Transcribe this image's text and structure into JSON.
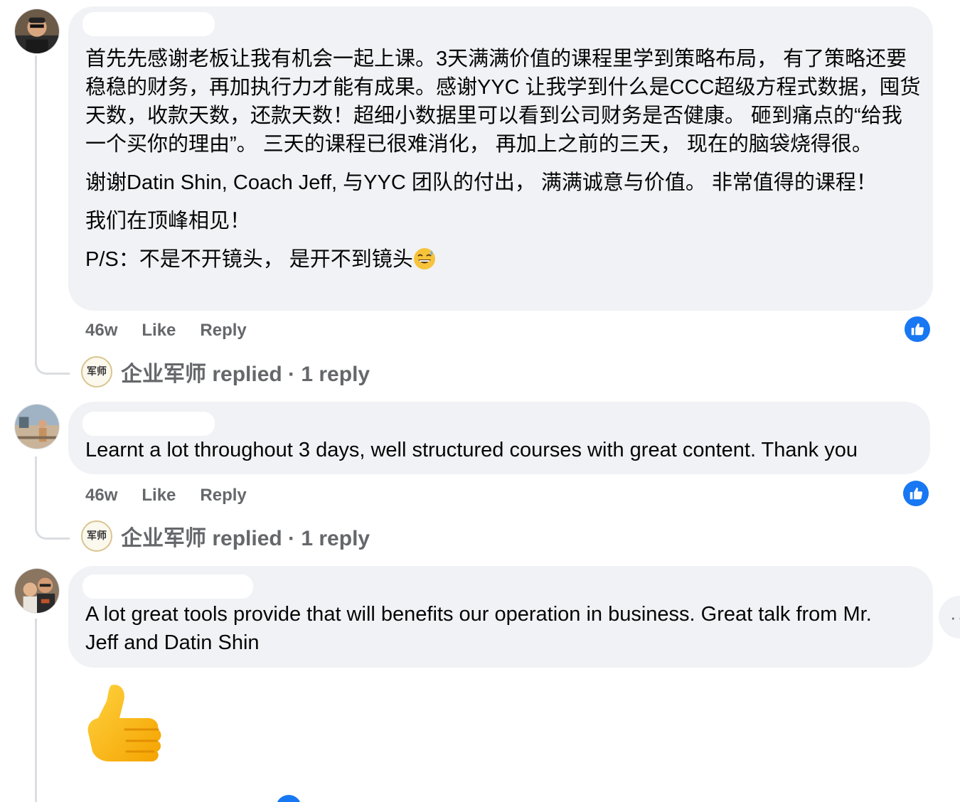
{
  "comments": [
    {
      "paragraphs": [
        "首先先感谢老板让我有机会一起上课。3天满满价值的课程里学到策略布局， 有了策略还要稳稳的财务，再加执行力才能有成果。感谢YYC 让我学到什么是CCC超级方程式数据，囤货天数，收款天数，还款天数！超细小数据里可以看到公司财务是否健康。 砸到痛点的“给我一个买你的理由”。 三天的课程已很难消化， 再加上之前的三天， 现在的脑袋烧得很。",
        "谢谢Datin Shin, Coach Jeff, 与YYC 团队的付出， 满满诚意与价值。 非常值得的课程！",
        "我们在顶峰相见！",
        "P/S：不是不开镜头， 是开不到镜头"
      ],
      "emoji": "sweat-smile-emoji",
      "time": "46w",
      "like": "Like",
      "reply": "Reply",
      "replied": "企业军师 replied · 1 reply"
    },
    {
      "paragraphs": [
        "Learnt a lot throughout 3 days, well structured courses with great content. Thank you"
      ],
      "time": "46w",
      "like": "Like",
      "reply": "Reply",
      "replied": "企业军师 replied · 1 reply"
    },
    {
      "paragraphs": [
        "A lot great tools provide that will benefits our operation in business. Great talk from Mr. Jeff and Datin Shin"
      ],
      "sticker": "thumbs-up-sticker"
    }
  ],
  "page_avatar_text": "军师",
  "colors": {
    "bubble": "#f0f2f5",
    "like_blue": "#1877f2",
    "meta_gray": "#65676b",
    "thread_line": "#dadde1"
  }
}
